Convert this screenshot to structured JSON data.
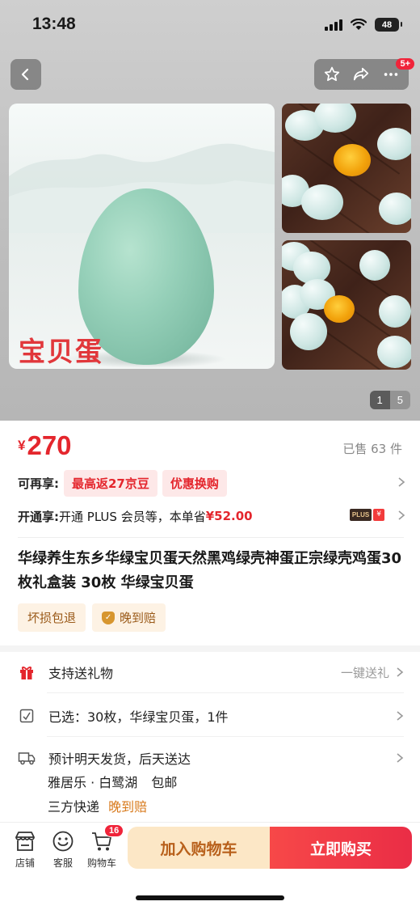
{
  "status_bar": {
    "time": "13:48",
    "battery": "48"
  },
  "nav": {
    "more_badge": "5+"
  },
  "gallery": {
    "main_image_text": "宝贝蛋",
    "page_current": "1",
    "page_total": "5",
    "icons": [
      "back-arrow-icon",
      "star-icon",
      "share-icon",
      "more-icon"
    ]
  },
  "product": {
    "currency": "¥",
    "price": "270",
    "sold": "已售 63 件",
    "benefits_label": "可再享:",
    "benefit_tags": [
      "最高返27京豆",
      "优惠换购"
    ],
    "plus_label": "开通享:",
    "plus_text": "开通 PLUS 会员等，本单省",
    "plus_save": "¥52.00",
    "plus_logo": [
      "PLUS",
      "¥"
    ],
    "title": "华绿养生东乡华绿宝贝蛋天然黑鸡绿壳神蛋正宗绿壳鸡蛋30枚礼盒装 30枚 华绿宝贝蛋",
    "service_tags": [
      "坏损包退",
      "晚到赔"
    ],
    "shield_mark": "✓"
  },
  "details": {
    "gift_label": "支持送礼物",
    "gift_action": "一键送礼",
    "selected_text": "已选：30枚，华绿宝贝蛋，1件",
    "ship_estimate": "预计明天发货，后天送达",
    "ship_location": "雅居乐 · 白鹭湖",
    "ship_free": "包邮",
    "ship_courier": "三方快递",
    "ship_late": "晚到赔"
  },
  "bottom_bar": {
    "shop": "店铺",
    "service": "客服",
    "cart": "购物车",
    "cart_count": "16",
    "add_to_cart": "加入购物车",
    "buy_now": "立即购买"
  },
  "colors": {
    "accent_red": "#e4262d",
    "buy_gradient": "#ea2d46",
    "cart_bg": "#fce7c6"
  }
}
